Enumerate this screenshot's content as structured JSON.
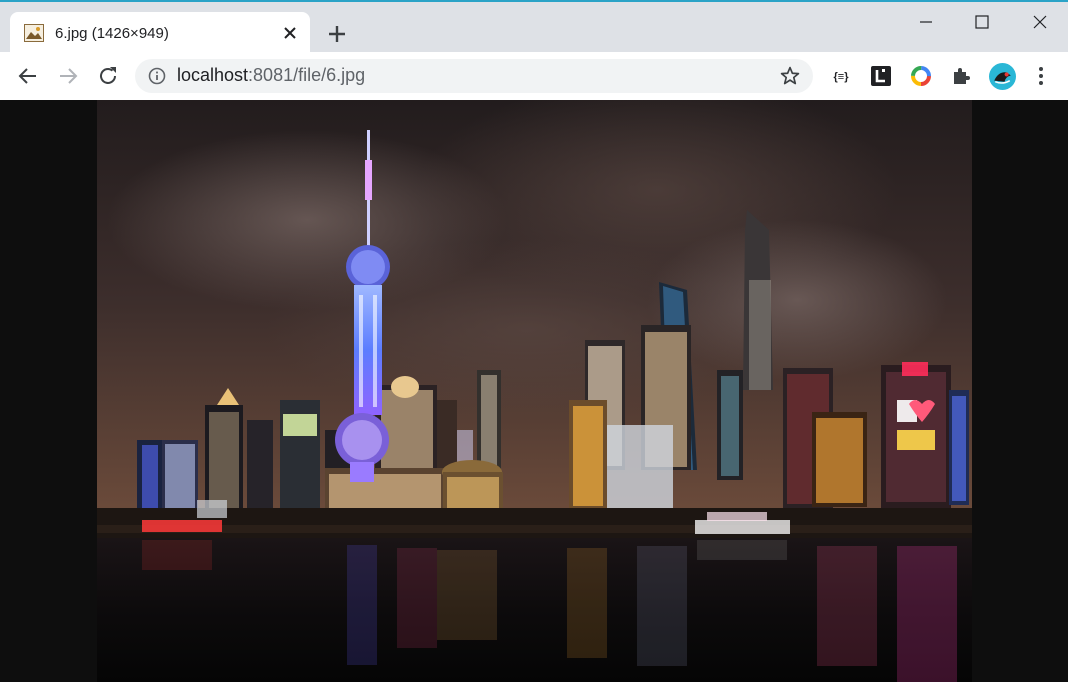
{
  "tab": {
    "title": "6.jpg (1426×949)"
  },
  "address": {
    "host": "localhost",
    "path": ":8081/file/6.jpg"
  },
  "icons": {
    "favicon": "image-file-icon",
    "close": "close-icon",
    "new_tab": "plus-icon",
    "minimize": "minimize-icon",
    "maximize": "maximize-icon",
    "window_close": "window-close-icon",
    "back": "back-arrow-icon",
    "forward": "forward-arrow-icon",
    "reload": "reload-icon",
    "info": "info-icon",
    "bookmark": "star-icon",
    "extensions": [
      "json-viewer-icon",
      "l-extension-icon",
      "color-ring-icon",
      "puzzle-icon",
      "profile-avatar-icon",
      "menu-dots-icon"
    ]
  },
  "colors": {
    "accent": "#2aa3c7",
    "tabstrip": "#dee1e6",
    "viewer_bg": "#0e0e0e"
  }
}
